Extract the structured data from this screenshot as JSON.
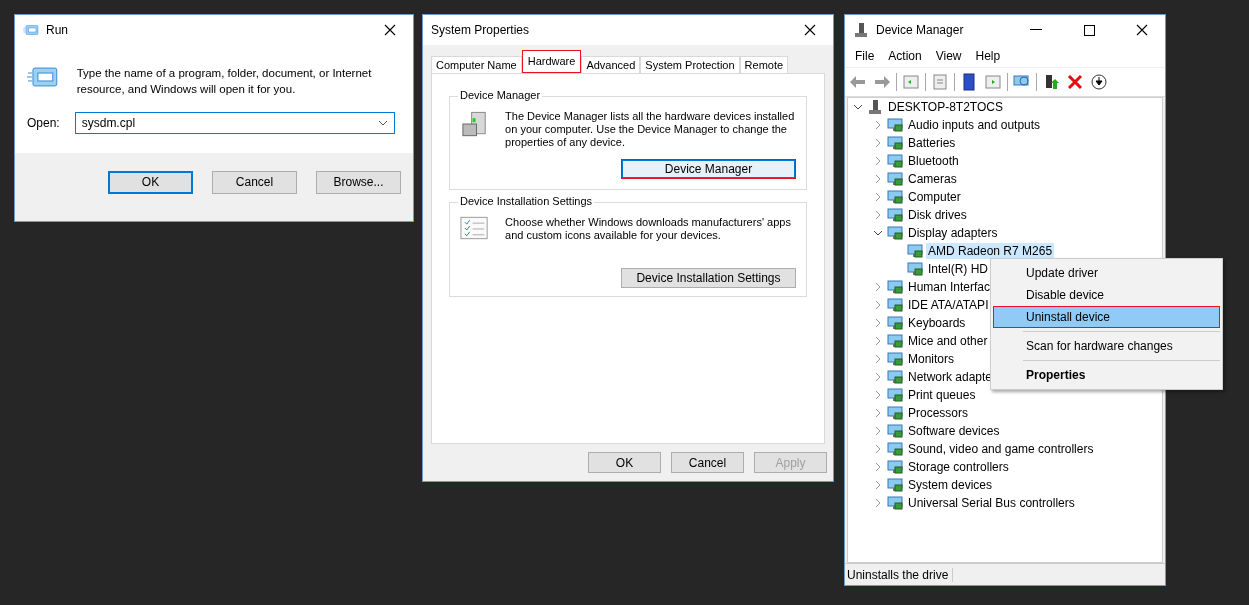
{
  "run_dialog": {
    "title": "Run",
    "message": "Type the name of a program, folder, document, or Internet resource, and Windows will open it for you.",
    "open_label": "Open:",
    "open_value": "sysdm.cpl",
    "buttons": [
      {
        "label": "OK",
        "default": true
      },
      {
        "label": "Cancel",
        "default": false
      },
      {
        "label": "Browse...",
        "default": false
      }
    ]
  },
  "system_properties": {
    "title": "System Properties",
    "tabs": [
      {
        "label": "Computer Name",
        "selected": false,
        "annotated": false
      },
      {
        "label": "Hardware",
        "selected": true,
        "annotated": true
      },
      {
        "label": "Advanced",
        "selected": false,
        "annotated": false
      },
      {
        "label": "System Protection",
        "selected": false,
        "annotated": false
      },
      {
        "label": "Remote",
        "selected": false,
        "annotated": false
      }
    ],
    "groups": [
      {
        "kind": "device-manager",
        "title": "Device Manager",
        "text": "The Device Manager lists all the hardware devices installed on your computer. Use the Device Manager to change the properties of any device.",
        "button": {
          "label": "Device Manager",
          "focused": true,
          "annotated": true
        }
      },
      {
        "kind": "install-settings",
        "title": "Device Installation Settings",
        "text": "Choose whether Windows downloads manufacturers' apps and custom icons available for your devices.",
        "button": {
          "label": "Device Installation Settings",
          "focused": false,
          "annotated": false
        }
      }
    ],
    "buttons": [
      {
        "label": "OK",
        "disabled": false
      },
      {
        "label": "Cancel",
        "disabled": false
      },
      {
        "label": "Apply",
        "disabled": true
      }
    ]
  },
  "device_manager": {
    "title": "Device Manager",
    "menu": [
      "File",
      "Action",
      "View",
      "Help"
    ],
    "tree": {
      "label": "DESKTOP-8T2TOCS",
      "expanded": true,
      "selected": false,
      "children": [
        {
          "label": "Audio inputs and outputs",
          "expanded": false,
          "selected": false
        },
        {
          "label": "Batteries",
          "expanded": false,
          "selected": false
        },
        {
          "label": "Bluetooth",
          "expanded": false,
          "selected": false
        },
        {
          "label": "Cameras",
          "expanded": false,
          "selected": false
        },
        {
          "label": "Computer",
          "expanded": false,
          "selected": false
        },
        {
          "label": "Disk drives",
          "expanded": false,
          "selected": false
        },
        {
          "label": "Display adapters",
          "expanded": true,
          "selected": false,
          "children": [
            {
              "label": "AMD Radeon R7 M265",
              "selected": true
            },
            {
              "label": "Intel(R) HD",
              "selected": false
            }
          ]
        },
        {
          "label": "Human Interfac",
          "expanded": false,
          "selected": false
        },
        {
          "label": "IDE ATA/ATAPI",
          "expanded": false,
          "selected": false
        },
        {
          "label": "Keyboards",
          "expanded": false,
          "selected": false
        },
        {
          "label": "Mice and other",
          "expanded": false,
          "selected": false
        },
        {
          "label": "Monitors",
          "expanded": false,
          "selected": false
        },
        {
          "label": "Network adapte",
          "expanded": false,
          "selected": false
        },
        {
          "label": "Print queues",
          "expanded": false,
          "selected": false
        },
        {
          "label": "Processors",
          "expanded": false,
          "selected": false
        },
        {
          "label": "Software devices",
          "expanded": false,
          "selected": false
        },
        {
          "label": "Sound, video and game controllers",
          "expanded": false,
          "selected": false
        },
        {
          "label": "Storage controllers",
          "expanded": false,
          "selected": false
        },
        {
          "label": "System devices",
          "expanded": false,
          "selected": false
        },
        {
          "label": "Universal Serial Bus controllers",
          "expanded": false,
          "selected": false
        }
      ]
    },
    "status_bar": "Uninstalls the drive"
  },
  "context_menu": {
    "items": [
      {
        "kind": "item",
        "label": "Update driver",
        "selected": false,
        "annotated": false
      },
      {
        "kind": "item",
        "label": "Disable device",
        "selected": false,
        "annotated": false
      },
      {
        "kind": "item",
        "label": "Uninstall device",
        "selected": true,
        "annotated": true
      },
      {
        "kind": "separator"
      },
      {
        "kind": "item",
        "label": "Scan for hardware changes",
        "selected": false,
        "annotated": false
      },
      {
        "kind": "separator"
      },
      {
        "kind": "default",
        "label": "Properties",
        "selected": false,
        "annotated": false
      }
    ]
  }
}
